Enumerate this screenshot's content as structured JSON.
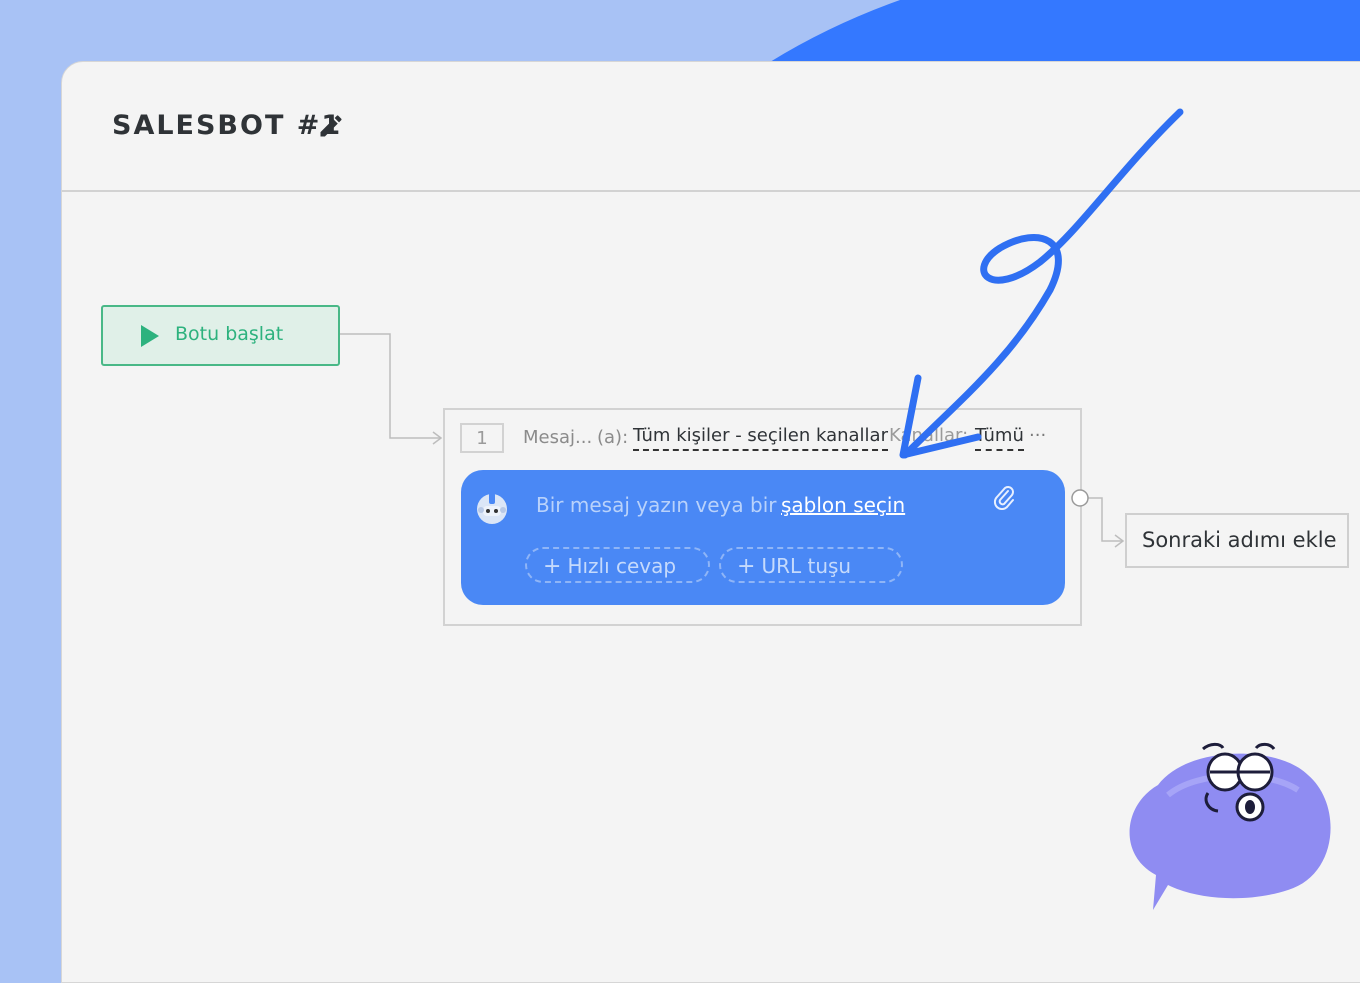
{
  "header": {
    "title": "SALESBOT #1"
  },
  "flow": {
    "start_node": {
      "label": "Botu başlat"
    },
    "step": {
      "number": "1",
      "type_label": "Mesaj...",
      "sub_label": "(a):",
      "target": "Tüm kişiler - seçilen kanallar",
      "channel_label": "Kanallar:",
      "channel_value": "Tümü",
      "more": "···"
    },
    "message_card": {
      "placeholder": "Bir mesaj yazın veya bir",
      "template_link": "şablon seçin",
      "quick_reply": "Hızlı cevap",
      "url_button": "URL tuşu"
    },
    "next_step": {
      "label": "Sonraki adımı ekle"
    }
  },
  "colors": {
    "background": "#a8c2f5",
    "accent_blob": "#3478ff",
    "start_green": "#2db27e",
    "message_blue": "#4a88f5",
    "annotation": "#2f6ff2"
  },
  "icons": [
    "edit-icon",
    "play-icon",
    "bot-avatar-icon",
    "attachment-icon",
    "chat-bubble-mascot"
  ]
}
